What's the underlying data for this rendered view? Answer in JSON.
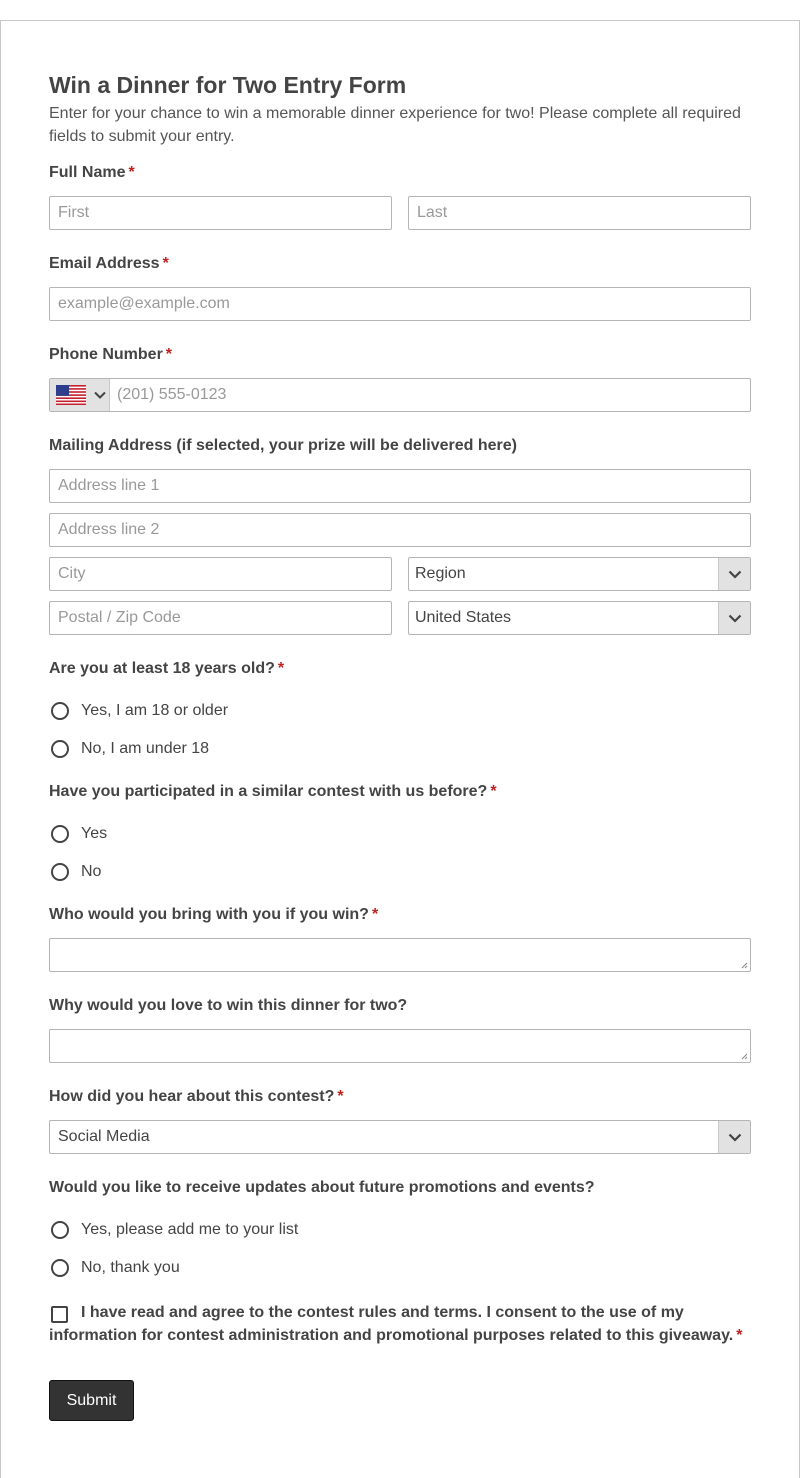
{
  "form": {
    "title": "Win a Dinner for Two Entry Form",
    "description": "Enter for your chance to win a memorable dinner experience for two! Please complete all required fields to submit your entry."
  },
  "full_name": {
    "label": "Full Name",
    "first_placeholder": "First",
    "last_placeholder": "Last"
  },
  "email": {
    "label": "Email Address",
    "placeholder": "example@example.com"
  },
  "phone": {
    "label": "Phone Number",
    "country_flag_icon": "us-flag-icon",
    "placeholder": "(201) 555-0123"
  },
  "address": {
    "label": "Mailing Address (if selected, your prize will be delivered here)",
    "line1_placeholder": "Address line 1",
    "line2_placeholder": "Address line 2",
    "city_placeholder": "City",
    "region_value": "Region",
    "postal_placeholder": "Postal / Zip Code",
    "country_value": "United States"
  },
  "age": {
    "label": "Are you at least 18 years old?",
    "options": [
      "Yes, I am 18 or older",
      "No, I am under 18"
    ]
  },
  "participated": {
    "label": "Have you participated in a similar contest with us before?",
    "options": [
      "Yes",
      "No"
    ]
  },
  "companion": {
    "label": "Who would you bring with you if you win?"
  },
  "reason": {
    "label": "Why would you love to win this dinner for two?"
  },
  "source": {
    "label": "How did you hear about this contest?",
    "value": "Social Media"
  },
  "updates": {
    "label": "Would you like to receive updates about future promotions and events?",
    "options": [
      "Yes, please add me to your list",
      "No, thank you"
    ]
  },
  "consent": {
    "text": "I have read and agree to the contest rules and terms. I consent to the use of my information for contest administration and promotional purposes related to this giveaway."
  },
  "required_marker": "*",
  "submit_label": "Submit",
  "colors": {
    "required": "#c0211f",
    "button": "#333333",
    "border": "#b5b5b5"
  }
}
